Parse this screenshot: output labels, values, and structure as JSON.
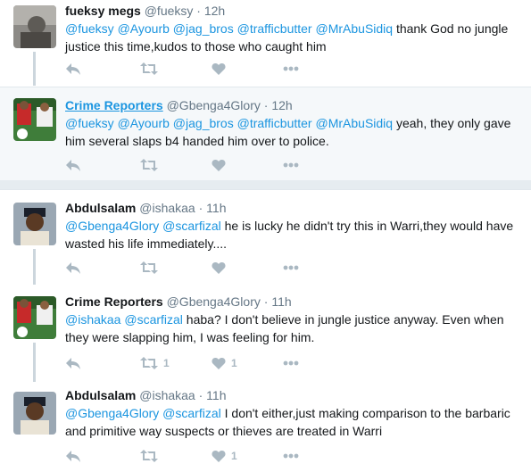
{
  "tweets": [
    {
      "name": "fueksy megs",
      "handle": "@fueksy",
      "time": "12h",
      "body": [
        {
          "t": "m",
          "v": "@fueksy"
        },
        {
          "t": "s",
          "v": " "
        },
        {
          "t": "m",
          "v": "@Ayourb"
        },
        {
          "t": "s",
          "v": " "
        },
        {
          "t": "m",
          "v": "@jag_bros"
        },
        {
          "t": "s",
          "v": " "
        },
        {
          "t": "m",
          "v": "@trafficbutter"
        },
        {
          "t": "s",
          "v": " "
        },
        {
          "t": "m",
          "v": "@MrAbuSidiq"
        },
        {
          "t": "s",
          "v": " thank God no jungle justice this time,kudos to those who caught him"
        }
      ],
      "retweets": "",
      "likes": ""
    },
    {
      "name": "Crime Reporters",
      "handle": "@Gbenga4Glory",
      "time": "12h",
      "body": [
        {
          "t": "m",
          "v": "@fueksy"
        },
        {
          "t": "s",
          "v": " "
        },
        {
          "t": "m",
          "v": "@Ayourb"
        },
        {
          "t": "s",
          "v": " "
        },
        {
          "t": "m",
          "v": "@jag_bros"
        },
        {
          "t": "s",
          "v": " "
        },
        {
          "t": "m",
          "v": "@trafficbutter"
        },
        {
          "t": "s",
          "v": " "
        },
        {
          "t": "m",
          "v": "@MrAbuSidiq"
        },
        {
          "t": "s",
          "v": " yeah, they only gave him several slaps b4 handed him over to police."
        }
      ],
      "retweets": "",
      "likes": ""
    },
    {
      "name": "Abdulsalam",
      "handle": "@ishakaa",
      "time": "11h",
      "body": [
        {
          "t": "m",
          "v": "@Gbenga4Glory"
        },
        {
          "t": "s",
          "v": " "
        },
        {
          "t": "m",
          "v": "@scarfizal"
        },
        {
          "t": "s",
          "v": " he is lucky he didn't try this in Warri,they would have wasted his life immediately...."
        }
      ],
      "retweets": "",
      "likes": ""
    },
    {
      "name": "Crime Reporters",
      "handle": "@Gbenga4Glory",
      "time": "11h",
      "body": [
        {
          "t": "m",
          "v": "@ishakaa"
        },
        {
          "t": "s",
          "v": " "
        },
        {
          "t": "m",
          "v": "@scarfizal"
        },
        {
          "t": "s",
          "v": " haba? I don't believe in jungle justice anyway. Even when they were slapping him, I was feeling for him."
        }
      ],
      "retweets": "1",
      "likes": "1"
    },
    {
      "name": "Abdulsalam",
      "handle": "@ishakaa",
      "time": "11h",
      "body": [
        {
          "t": "m",
          "v": "@Gbenga4Glory"
        },
        {
          "t": "s",
          "v": " "
        },
        {
          "t": "m",
          "v": "@scarfizal"
        },
        {
          "t": "s",
          "v": " I don't either,just making comparison to the barbaric and primitive way suspects or thieves are treated in Warri"
        }
      ],
      "retweets": "",
      "likes": "1"
    }
  ],
  "separator": "·",
  "icons": [
    "reply-icon",
    "retweet-icon",
    "like-icon",
    "more-icon"
  ],
  "colors": {
    "mention": "#1b95e0",
    "muted": "#657786",
    "icon": "#aab8c2",
    "highlight_bg": "#f5f8fa",
    "connector": "#ccd6dd"
  }
}
